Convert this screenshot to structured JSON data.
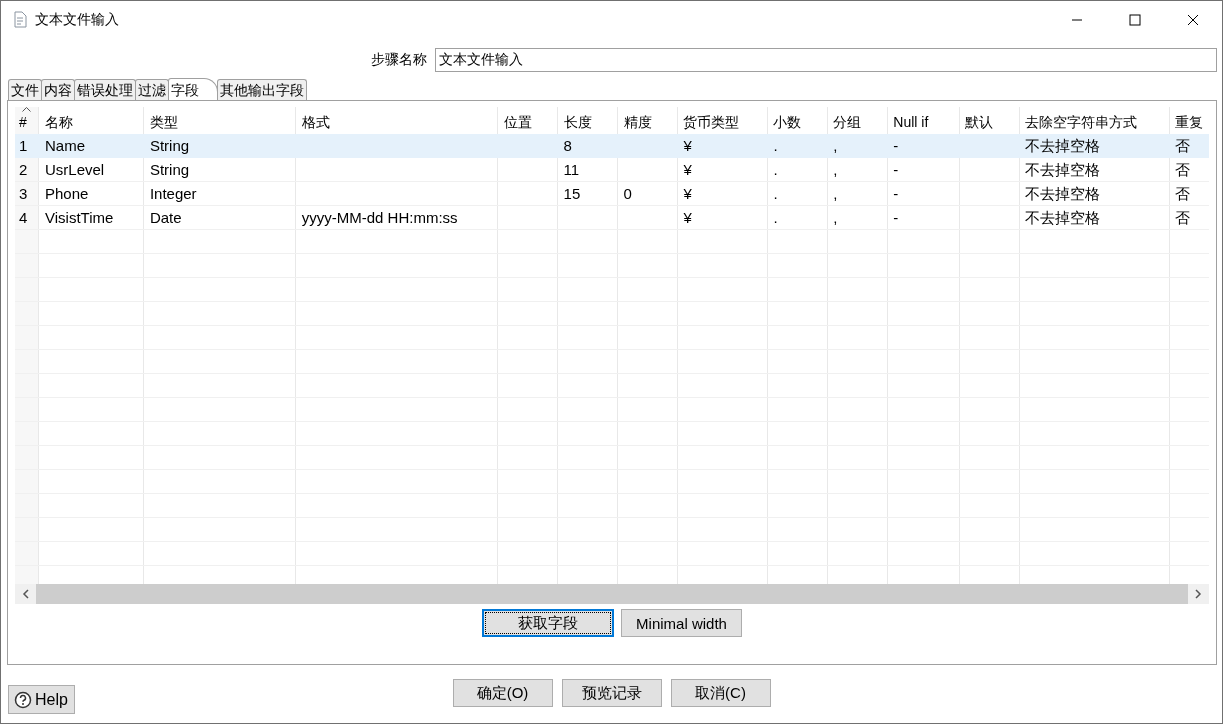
{
  "window": {
    "title": "文本文件输入"
  },
  "step_name": {
    "label": "步骤名称",
    "value": "文本文件输入"
  },
  "tabs": [
    {
      "label": "文件",
      "selected": false
    },
    {
      "label": "内容",
      "selected": false
    },
    {
      "label": "错误处理",
      "selected": false
    },
    {
      "label": "过滤",
      "selected": false
    },
    {
      "label": "字段",
      "selected": true
    },
    {
      "label": "其他输出字段",
      "selected": false
    }
  ],
  "table": {
    "columns": [
      "#",
      "名称",
      "类型",
      "格式",
      "位置",
      "长度",
      "精度",
      "货币类型",
      "小数",
      "分组",
      "Null if",
      "默认",
      "去除空字符串方式",
      "重复"
    ],
    "rows": [
      {
        "selected": true,
        "cells": [
          "1",
          "Name",
          "String",
          "",
          "",
          "8",
          "",
          "¥",
          ".",
          ",",
          "-",
          "",
          "不去掉空格",
          "否"
        ]
      },
      {
        "selected": false,
        "cells": [
          "2",
          "UsrLevel",
          "String",
          "",
          "",
          "11",
          "",
          "¥",
          ".",
          ",",
          "-",
          "",
          "不去掉空格",
          "否"
        ]
      },
      {
        "selected": false,
        "cells": [
          "3",
          "Phone",
          "Integer",
          "",
          "",
          "15",
          "0",
          "¥",
          ".",
          ",",
          "-",
          "",
          "不去掉空格",
          "否"
        ]
      },
      {
        "selected": false,
        "cells": [
          "4",
          "VisistTime",
          "Date",
          "yyyy-MM-dd HH:mm:ss",
          "",
          "",
          "",
          "¥",
          ".",
          ",",
          "-",
          "",
          "不去掉空格",
          "否"
        ]
      }
    ]
  },
  "table_buttons": [
    {
      "label": "获取字段",
      "focused": true
    },
    {
      "label": "Minimal width",
      "focused": false
    }
  ],
  "dialog_buttons": [
    "确定(O)",
    "预览记录",
    "取消(C)"
  ],
  "help_button": {
    "label": "Help"
  }
}
